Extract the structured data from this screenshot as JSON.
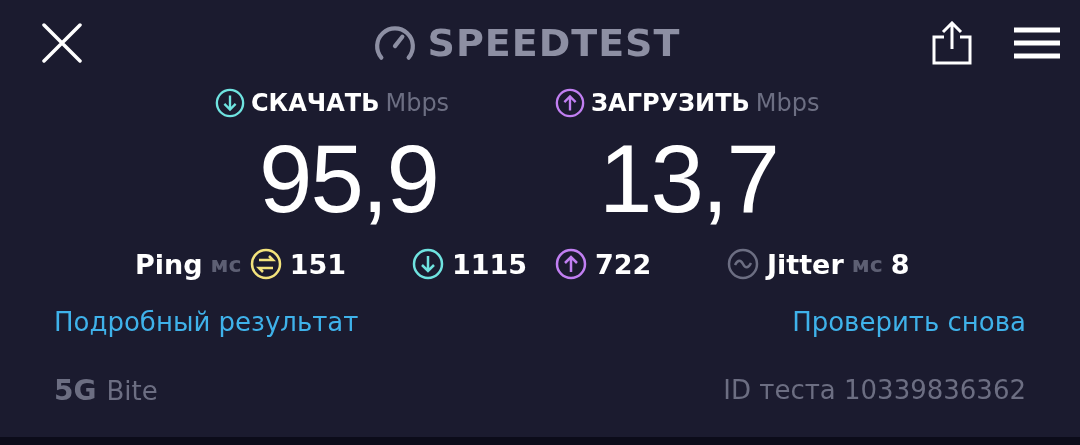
{
  "header": {
    "title": "SPEEDTEST"
  },
  "metrics": [
    {
      "kind": "download",
      "label": "СКАЧАТЬ",
      "unit": "Mbps",
      "value": "95,9"
    },
    {
      "kind": "upload",
      "label": "ЗАГРУЗИТЬ",
      "unit": "Mbps",
      "value": "13,7"
    }
  ],
  "stats": [
    {
      "kind": "ping",
      "label": "Ping",
      "unit": "мс",
      "value": "151"
    },
    {
      "kind": "download",
      "value": "1115"
    },
    {
      "kind": "upload",
      "value": "722"
    },
    {
      "kind": "jitter",
      "label": "Jitter",
      "unit": "мс",
      "value": "8"
    }
  ],
  "links": [
    "Подробный результат",
    "Проверить снова"
  ],
  "footer": {
    "network": "5G",
    "provider": "Bite",
    "test_id": "ID теста 10339836362"
  }
}
